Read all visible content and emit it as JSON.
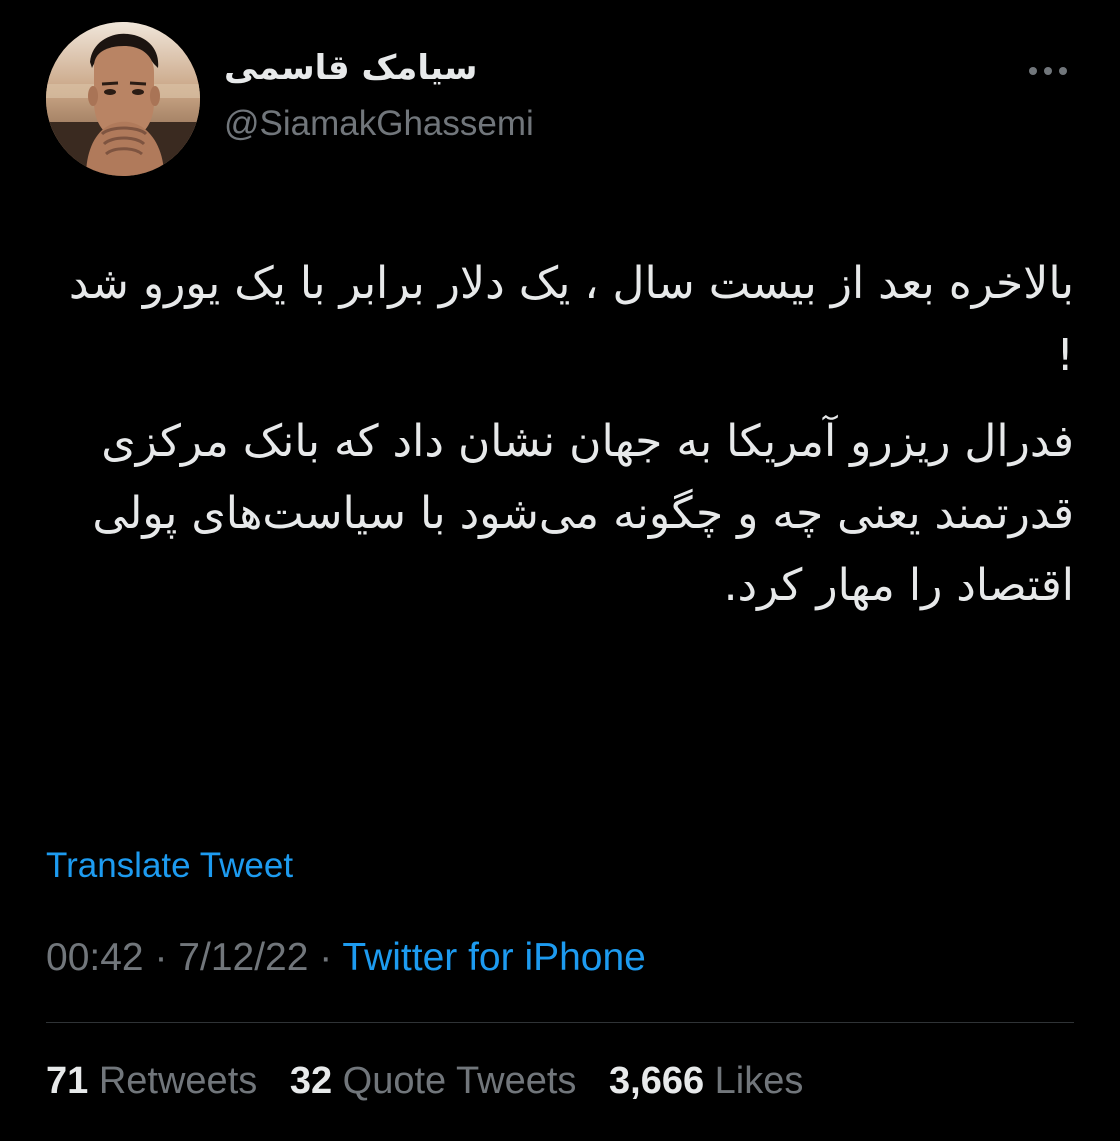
{
  "author": {
    "display_name": "سیامک قاسمی",
    "handle": "@SiamakGhassemi",
    "avatar_icon": "profile-photo"
  },
  "menu_icon": "more-horizontal-icon",
  "tweet": {
    "paragraphs": [
      "بالاخره بعد از بیست سال ، یک دلار برابر با یک یورو شد !",
      "فدرال ریزرو آمریکا به جهان نشان داد که بانک مرکزی قدرتمند یعنی چه و چگونه می‌شود با سیاست‌های پولی اقتصاد را مهار کرد."
    ]
  },
  "translate_label": "Translate Tweet",
  "meta": {
    "time": "00:42",
    "separator": "·",
    "date": "7/12/22",
    "source": "Twitter for iPhone"
  },
  "stats": {
    "retweets": {
      "count": "71",
      "label": "Retweets"
    },
    "quote_tweets": {
      "count": "32",
      "label": "Quote Tweets"
    },
    "likes": {
      "count": "3,666",
      "label": "Likes"
    }
  },
  "colors": {
    "background": "#000000",
    "text": "#e7e9ea",
    "secondary": "#71767b",
    "accent": "#1d9bf0",
    "divider": "#2f3336"
  }
}
